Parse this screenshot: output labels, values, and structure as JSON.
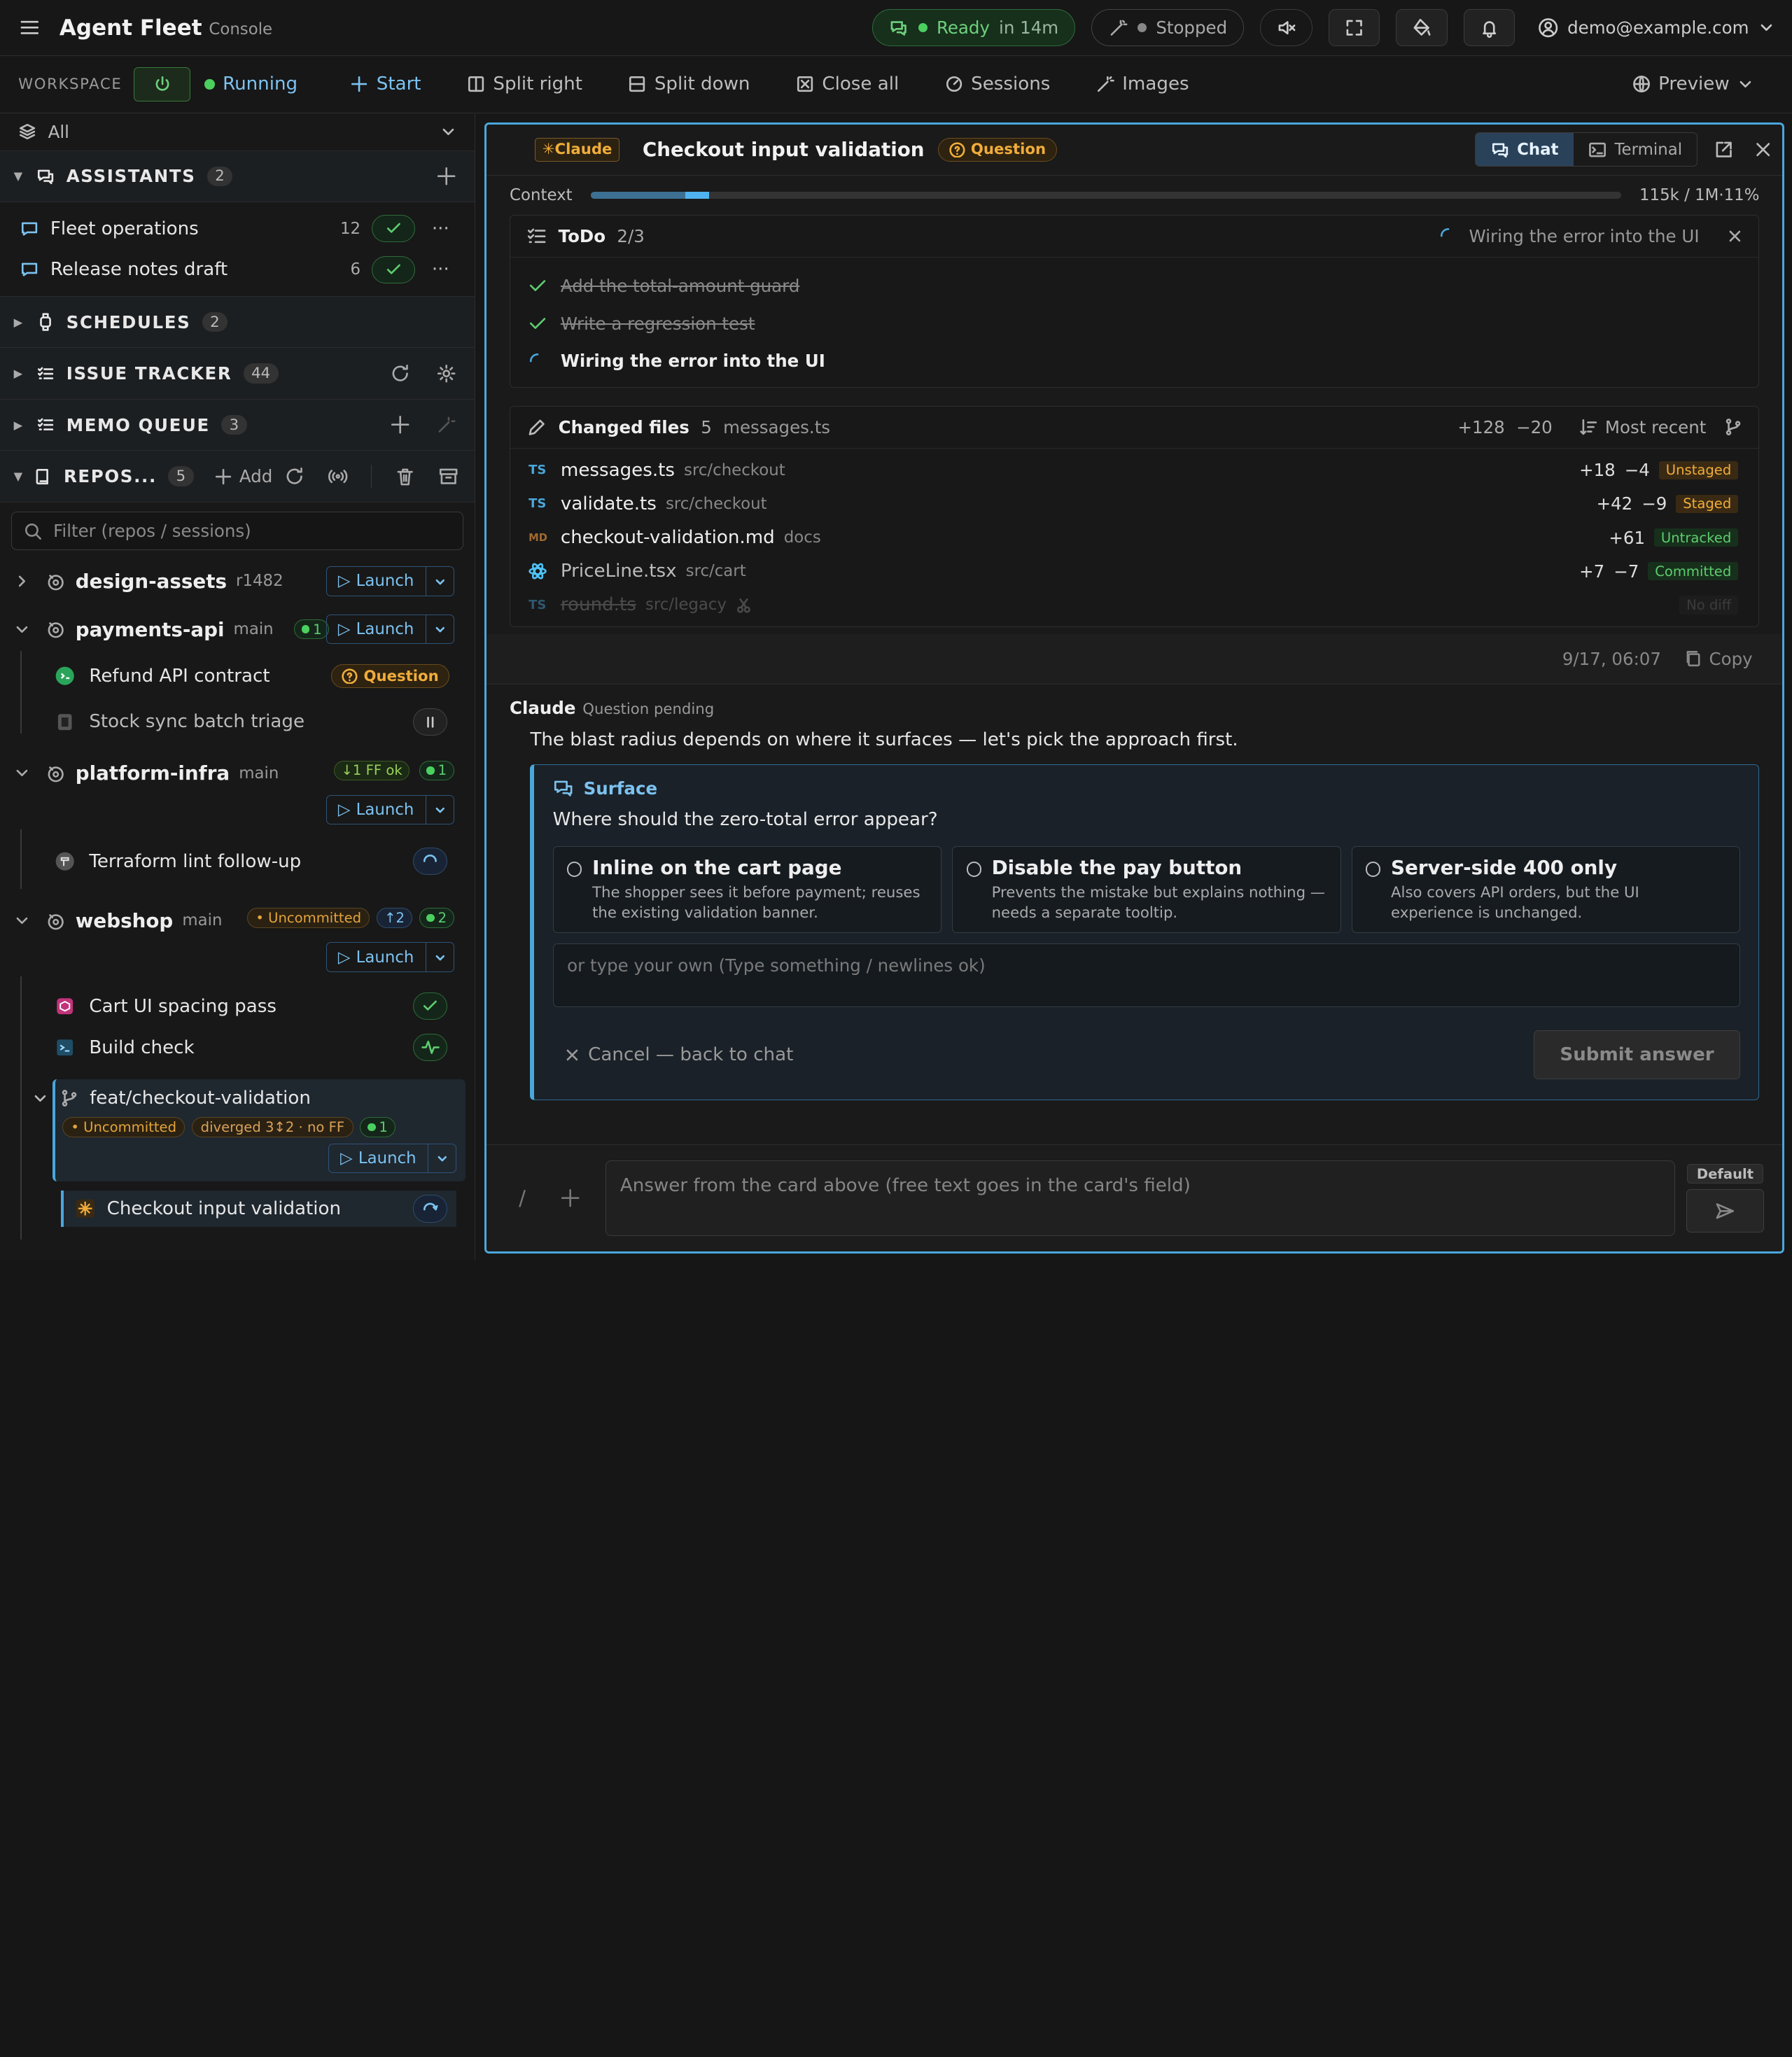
{
  "topbar": {
    "brand": "Agent Fleet",
    "brand_sub": "Console",
    "ready_label": "Ready",
    "ready_eta": "in 14m",
    "stopped_label": "Stopped",
    "user_email": "demo@example.com"
  },
  "workspace": {
    "label": "WORKSPACE",
    "status": "Running",
    "start": "Start",
    "split_right": "Split right",
    "split_down": "Split down",
    "close_all": "Close all",
    "sessions": "Sessions",
    "images": "Images",
    "preview": "Preview"
  },
  "sidebar": {
    "filter_all": "All",
    "assistants": {
      "title": "ASSISTANTS",
      "count": "2",
      "items": [
        {
          "label": "Fleet operations",
          "count": "12"
        },
        {
          "label": "Release notes draft",
          "count": "6"
        }
      ]
    },
    "schedules": {
      "title": "SCHEDULES",
      "count": "2"
    },
    "issue_tracker": {
      "title": "ISSUE TRACKER",
      "count": "44"
    },
    "memo_queue": {
      "title": "MEMO QUEUE",
      "count": "3"
    },
    "repos": {
      "title": "REPOS...",
      "count": "5",
      "add": "Add"
    },
    "search_placeholder": "Filter (repos / sessions)",
    "launch": "Launch",
    "repo_list": [
      {
        "name": "design-assets",
        "branch": "r1482"
      },
      {
        "name": "payments-api",
        "branch": "main",
        "badge": "1"
      },
      {
        "name": "platform-infra",
        "branch": "main",
        "ff": "↓1 FF ok",
        "badge": "1"
      },
      {
        "name": "webshop",
        "branch": "main",
        "uncommitted": "Uncommitted",
        "ahead": "↑2",
        "badge": "2"
      }
    ],
    "sessions": {
      "refund": "Refund API contract",
      "refund_status": "Question",
      "stock": "Stock sync batch triage",
      "terraform": "Terraform lint follow-up",
      "cart": "Cart UI spacing pass",
      "build": "Build check",
      "checkout": "Checkout input validation"
    },
    "branch": {
      "name": "feat/checkout-validation",
      "uncommitted": "Uncommitted",
      "diverged": "diverged 3↕2 · no FF",
      "badge": "1"
    }
  },
  "panel": {
    "agent": "Claude",
    "title": "Checkout input validation",
    "status": "Question",
    "tab_chat": "Chat",
    "tab_terminal": "Terminal",
    "context_label": "Context",
    "context_value": "115k / 1M·11%",
    "context_fraction": 0.115,
    "todo": {
      "title": "ToDo",
      "progress": "2/3",
      "current": "Wiring the error into the UI",
      "items": [
        {
          "label": "Add the total-amount guard",
          "state": "done"
        },
        {
          "label": "Write a regression test",
          "state": "done"
        },
        {
          "label": "Wiring the error into the UI",
          "state": "active"
        }
      ]
    },
    "changed": {
      "title": "Changed files",
      "count": "5",
      "latest": "messages.ts",
      "added": "+128",
      "removed": "−20",
      "sort": "Most recent",
      "files": [
        {
          "name": "messages.ts",
          "dir": "src/checkout",
          "add": "+18",
          "del": "−4",
          "state": "Unstaged",
          "kind": "TS"
        },
        {
          "name": "validate.ts",
          "dir": "src/checkout",
          "add": "+42",
          "del": "−9",
          "state": "Staged",
          "kind": "TS"
        },
        {
          "name": "checkout-validation.md",
          "dir": "docs",
          "add": "+61",
          "del": "",
          "state": "Untracked",
          "kind": "MD"
        },
        {
          "name": "PriceLine.tsx",
          "dir": "src/cart",
          "add": "+7",
          "del": "−7",
          "state": "Committed",
          "kind": "TSX"
        },
        {
          "name": "round.ts",
          "dir": "src/legacy",
          "add": "",
          "del": "",
          "state": "No diff",
          "kind": "TS"
        }
      ]
    },
    "timestamp": "9/17, 06:07",
    "copy": "Copy",
    "message": {
      "author": "Claude",
      "state": "Question pending",
      "text": "The blast radius depends on where it surfaces — let's pick the approach first."
    },
    "card": {
      "header": "Surface",
      "question": "Where should the zero-total error appear?",
      "options": [
        {
          "title": "Inline on the cart page",
          "desc": "The shopper sees it before payment; reuses the existing validation banner."
        },
        {
          "title": "Disable the pay button",
          "desc": "Prevents the mistake but explains nothing — needs a separate tooltip."
        },
        {
          "title": "Server-side 400 only",
          "desc": "Also covers API orders, but the UI experience is unchanged."
        }
      ],
      "custom_placeholder": "or type your own (Type something / newlines ok)",
      "cancel": "Cancel — back to chat",
      "submit": "Submit answer"
    },
    "composer": {
      "slash": "/",
      "placeholder": "Answer from the card above (free text goes in the card's field)",
      "mode": "Default"
    }
  }
}
